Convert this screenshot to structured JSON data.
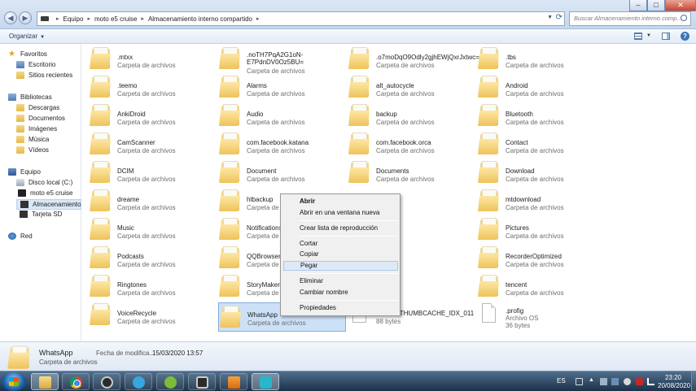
{
  "window": {
    "minimize_label": "–",
    "maximize_label": "□",
    "close_label": "✕"
  },
  "address": {
    "crumbs": [
      "Equipo",
      "moto e5 cruise",
      "Almacenamiento interno compartido"
    ]
  },
  "search": {
    "placeholder": "Buscar Almacenamiento interno comp..."
  },
  "toolbar": {
    "organize_label": "Organizar"
  },
  "nav": {
    "favorites": "Favoritos",
    "desktop": "Escritorio",
    "recent": "Sitios recientes",
    "libraries": "Bibliotecas",
    "downloads": "Descargas",
    "documents": "Documentos",
    "pictures": "Imágenes",
    "music": "Música",
    "videos": "Vídeos",
    "computer": "Equipo",
    "local_disk": "Disco local (C:)",
    "phone": "moto e5 cruise",
    "internal_storage": "Almacenamiento interno compartido",
    "sd_card": "Tarjeta SD",
    "network": "Red"
  },
  "items": [
    {
      "name": ".mtxx",
      "type": "Carpeta de archivos"
    },
    {
      "name": ".noTH7PqA2G1oN-E7PdnDV0Oz5BU=",
      "type": "Carpeta de archivos"
    },
    {
      "name": ".o7moDqO9Odly2gjhEWjQxrJxtwc=",
      "type": "Carpeta de archivos"
    },
    {
      "name": ".tbs",
      "type": "Carpeta de archivos"
    },
    {
      "name": ".teemo",
      "type": "Carpeta de archivos"
    },
    {
      "name": "Alarms",
      "type": "Carpeta de archivos"
    },
    {
      "name": "alt_autocycle",
      "type": "Carpeta de archivos"
    },
    {
      "name": "Android",
      "type": "Carpeta de archivos"
    },
    {
      "name": "AnkiDroid",
      "type": "Carpeta de archivos"
    },
    {
      "name": "Audio",
      "type": "Carpeta de archivos"
    },
    {
      "name": "backup",
      "type": "Carpeta de archivos"
    },
    {
      "name": "Bluetooth",
      "type": "Carpeta de archivos"
    },
    {
      "name": "CamScanner",
      "type": "Carpeta de archivos"
    },
    {
      "name": "com.facebook.katana",
      "type": "Carpeta de archivos"
    },
    {
      "name": "com.facebook.orca",
      "type": "Carpeta de archivos"
    },
    {
      "name": "Contact",
      "type": "Carpeta de archivos"
    },
    {
      "name": "DCIM",
      "type": "Carpeta de archivos"
    },
    {
      "name": "Document",
      "type": "Carpeta de archivos"
    },
    {
      "name": "Documents",
      "type": "Carpeta de archivos"
    },
    {
      "name": "Download",
      "type": "Carpeta de archivos"
    },
    {
      "name": "dreame",
      "type": "Carpeta de archivos"
    },
    {
      "name": "htbackup",
      "type": "Carpeta de archivos"
    },
    {
      "name": "mtdownload",
      "type": "Carpeta de archivos"
    },
    {
      "name": "Music",
      "type": "Carpeta de archivos"
    },
    {
      "name": "Notifications",
      "type": "Carpeta de archivos"
    },
    {
      "name": "Pictures",
      "type": "Carpeta de archivos"
    },
    {
      "name": "Podcasts",
      "type": "Carpeta de archivos"
    },
    {
      "name": "QQBrowser",
      "type": "Carpeta de archivos"
    },
    {
      "name": "RecorderOptimized",
      "type": "Carpeta de archivos"
    },
    {
      "name": "Ringtones",
      "type": "Carpeta de archivos"
    },
    {
      "name": "StoryMaker",
      "type": "Carpeta de archivos"
    },
    {
      "name": "tencent",
      "type": "Carpeta de archivos"
    },
    {
      "name": "VoiceRecycle",
      "type": "Carpeta de archivos"
    },
    {
      "name": "WhatsApp",
      "type": "Carpeta de archivos"
    },
    {
      "name": "Archivo THUMBCACHE_IDX_011",
      "type": "88 bytes"
    },
    {
      "name": ".profig",
      "type": "Archivo OS",
      "size": "36 bytes"
    }
  ],
  "context_menu": {
    "open": "Abrir",
    "open_new_window": "Abrir en una ventana nueva",
    "create_playlist": "Crear lista de reproducción",
    "cut": "Cortar",
    "copy": "Copiar",
    "paste": "Pegar",
    "delete": "Eliminar",
    "rename": "Cambiar nombre",
    "properties": "Propiedades"
  },
  "details": {
    "name": "WhatsApp",
    "type": "Carpeta de archivos",
    "modified_label": "Fecha de modifica...",
    "modified_value": "15/03/2020 13:57"
  },
  "taskbar": {
    "language": "ES",
    "time": "23:20",
    "date": "20/08/2020"
  }
}
